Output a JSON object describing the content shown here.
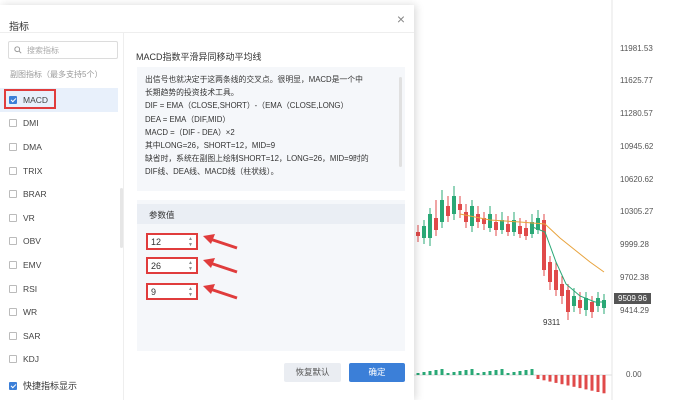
{
  "dialog": {
    "title": "指标",
    "close_glyph": "×"
  },
  "sidebar": {
    "search_placeholder": "搜索指标",
    "section_label": "副图指标（最多支持5个）",
    "items": [
      {
        "label": "MACD",
        "checked": true
      },
      {
        "label": "DMI",
        "checked": false
      },
      {
        "label": "DMA",
        "checked": false
      },
      {
        "label": "TRIX",
        "checked": false
      },
      {
        "label": "BRAR",
        "checked": false
      },
      {
        "label": "VR",
        "checked": false
      },
      {
        "label": "OBV",
        "checked": false
      },
      {
        "label": "EMV",
        "checked": false
      },
      {
        "label": "RSI",
        "checked": false
      },
      {
        "label": "WR",
        "checked": false
      },
      {
        "label": "SAR",
        "checked": false
      },
      {
        "label": "KDJ",
        "checked": false
      }
    ],
    "quick_show_label": "快捷指标显示"
  },
  "description": {
    "title": "MACD指数平滑异同移动平均线",
    "lines": [
      "出信号也就决定于这两条线的交叉点。很明显，MACD是一个中",
      "长期趋势的投资技术工具。",
      "DIF = EMA（CLOSE,SHORT）-（EMA（CLOSE,LONG）",
      "DEA = EMA（DIF,MID）",
      "MACD =（DIF - DEA）×2",
      "其中LONG=26，SHORT=12，MID=9",
      "缺省时，系统在副图上绘制SHORT=12，LONG=26，MID=9时的",
      "DIF线、DEA线、MACD线（柱状线）。"
    ]
  },
  "params": {
    "title": "参数值",
    "values": [
      "12",
      "26",
      "9"
    ]
  },
  "buttons": {
    "reset": "恢复默认",
    "ok": "确定"
  },
  "chart": {
    "price_labels": [
      "11981.53",
      "11625.77",
      "11280.57",
      "10945.62",
      "10620.62",
      "10305.27",
      "9999.28",
      "9702.38",
      "9414.29"
    ],
    "current_price": "9509.96",
    "low_label": "9311",
    "macd_zero": "0.00",
    "up_color": "#2aa876",
    "down_color": "#e04a4a",
    "ma1_color": "#e8a33d",
    "ma2_color": "#2aa876"
  }
}
